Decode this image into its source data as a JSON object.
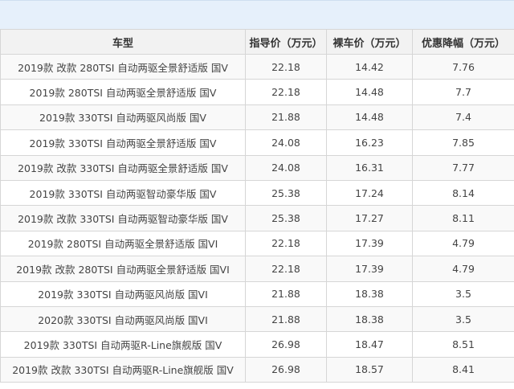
{
  "table": {
    "headers": {
      "model": "车型",
      "msrp": "指导价（万元）",
      "net_price": "裸车价（万元）",
      "discount": "优惠降幅（万元）"
    },
    "rows": [
      {
        "model": "2019款 改款 280TSI 自动两驱全景舒适版 国V",
        "msrp": "22.18",
        "net_price": "14.42",
        "discount": "7.76"
      },
      {
        "model": "2019款 280TSI 自动两驱全景舒适版 国V",
        "msrp": "22.18",
        "net_price": "14.48",
        "discount": "7.7"
      },
      {
        "model": "2019款 330TSI 自动两驱风尚版 国V",
        "msrp": "21.88",
        "net_price": "14.48",
        "discount": "7.4"
      },
      {
        "model": "2019款 330TSI 自动两驱全景舒适版 国V",
        "msrp": "24.08",
        "net_price": "16.23",
        "discount": "7.85"
      },
      {
        "model": "2019款 改款 330TSI 自动两驱全景舒适版 国V",
        "msrp": "24.08",
        "net_price": "16.31",
        "discount": "7.77"
      },
      {
        "model": "2019款 330TSI 自动两驱智动豪华版 国V",
        "msrp": "25.38",
        "net_price": "17.24",
        "discount": "8.14"
      },
      {
        "model": "2019款 改款 330TSI 自动两驱智动豪华版 国V",
        "msrp": "25.38",
        "net_price": "17.27",
        "discount": "8.11"
      },
      {
        "model": "2019款 280TSI 自动两驱全景舒适版 国VI",
        "msrp": "22.18",
        "net_price": "17.39",
        "discount": "4.79"
      },
      {
        "model": "2019款 改款 280TSI 自动两驱全景舒适版 国VI",
        "msrp": "22.18",
        "net_price": "17.39",
        "discount": "4.79"
      },
      {
        "model": "2019款 330TSI 自动两驱风尚版 国VI",
        "msrp": "21.88",
        "net_price": "18.38",
        "discount": "3.5"
      },
      {
        "model": "2020款 330TSI 自动两驱风尚版 国VI",
        "msrp": "21.88",
        "net_price": "18.38",
        "discount": "3.5"
      },
      {
        "model": "2019款 330TSI 自动两驱R-Line旗舰版 国V",
        "msrp": "26.98",
        "net_price": "18.47",
        "discount": "8.51"
      },
      {
        "model": "2019款 改款 330TSI 自动两驱R-Line旗舰版 国V",
        "msrp": "26.98",
        "net_price": "18.57",
        "discount": "8.41"
      }
    ]
  }
}
